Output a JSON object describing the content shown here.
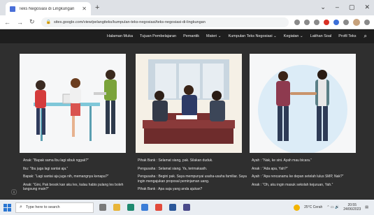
{
  "browser": {
    "tab_title": "Teks Negosiasi di Lingkungan",
    "url": "sites.google.com/view/pelangiteks/kumpulan-teks-negosiasi/teks-negosiasi-di-lingkungan"
  },
  "site_nav": {
    "items": [
      "Halaman Muka",
      "Tujuan Pembelajaran",
      "Pemantik",
      "Materi ⌄",
      "Kumpulan Teks Negosiasi ⌄",
      "Kegiatan ⌄",
      "Latihan Soal",
      "Profil Teks"
    ]
  },
  "dialogs": {
    "col1": [
      "Anak: “Bapak sama Ibu lagi sibuk nggak?”",
      "Ibu: “Ibu juga lagi santai aja.”",
      "Bapak: “Lagi santai aja juga nih, memangnya kenapa?”",
      "Anak: “Gini, Pak besok kan aku les, kalau habis pulang les boleh langsung main?”"
    ],
    "col2": [
      "Pihak Bank : Selamat siang, pak. Silakan duduk.",
      "Pengusaha : Selamat siang. Ya, terimakasih.",
      "Pengusaha : Begini pak. Saya mempunyai usaha-usaha familiar. Saya ingin mengajukan proposal peminjaman uang.",
      "Pihak Bank : Apa saja yang anda ajukan?"
    ],
    "col3": [
      "Ayah : “Nak, ke sini. Ayah mau bicara.”",
      "Anak : “Ada apa, Yah?”",
      "Ayah : “Apa rencanamu ke depan setelah lulus SMP, Nak?”",
      "Anak : “Oh, aku ingin masuk sekolah kejuruan, Yah.”"
    ]
  },
  "taskbar": {
    "search_placeholder": "Type here to search",
    "weather": "25°C Cerah",
    "time": "20:55",
    "date": "24/06/2023"
  },
  "colors": {
    "site_header": "#1e1e1e",
    "content_bg": "#2f2f2f",
    "accent_blue": "#2a76d2"
  }
}
